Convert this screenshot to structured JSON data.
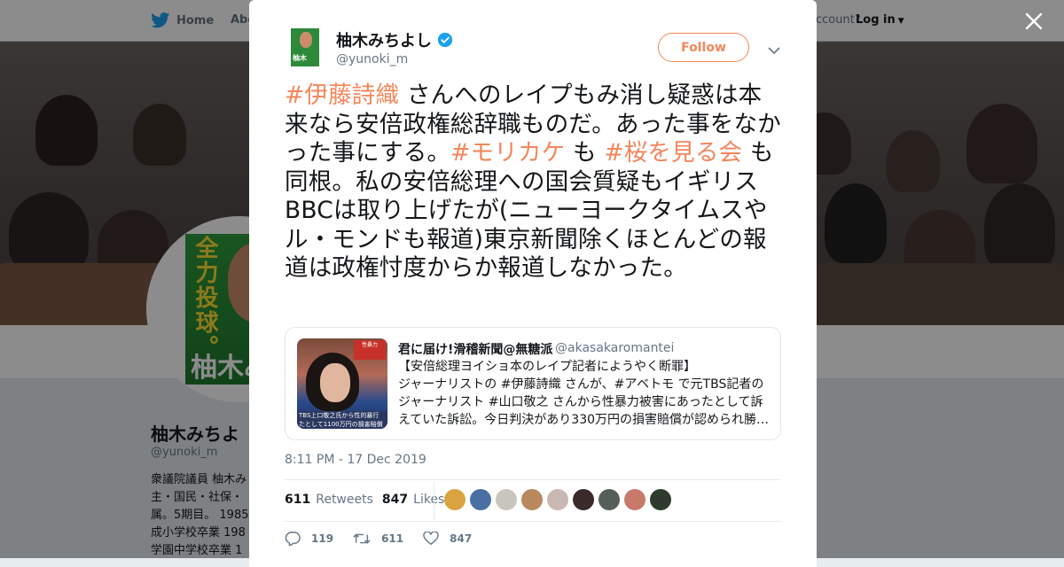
{
  "nav": {
    "home_label": "Home",
    "about_label": "Abo",
    "account_prompt": "ccount?",
    "login_label": "Log in"
  },
  "profile": {
    "name": "柚木みちよ",
    "handle": "@yunoki_m",
    "bio": "衆議院議員 柚木み\n主・国民・社保・\n属。5期目。 1985\n成小学校卒業 198\n学園中学校卒業 1",
    "avatar_text_top": "全力投球。",
    "avatar_text_bottom": "柚木み"
  },
  "tweet": {
    "author_name": "柚木みちよし",
    "author_handle": "@yunoki_m",
    "follow_label": "Follow",
    "body": [
      {
        "text": "#伊藤詩織",
        "tag": true
      },
      {
        "text": " さんへのレイプもみ消し疑惑は本来なら安倍政権総辞職ものだ。あった事をなかった事にする。",
        "tag": false
      },
      {
        "text": "#モリカケ",
        "tag": true
      },
      {
        "text": " も ",
        "tag": false
      },
      {
        "text": "#桜を見る会",
        "tag": true
      },
      {
        "text": " も同根。私の安倍総理への国会質疑もイギリスBBCは取り上げたが(ニューヨークタイムスやル・モンドも報道)東京新聞除くほとんどの報道は政権忖度からか報道しなかった。",
        "tag": false
      }
    ],
    "timestamp": "8:11 PM - 17 Dec 2019",
    "retweets_count": "611",
    "retweets_label": "Retweets",
    "likes_count": "847",
    "likes_label": "Likes",
    "reply_count": "119",
    "retweet_action_count": "611",
    "like_action_count": "847"
  },
  "quoted": {
    "name": "君に届け!滑稽新聞@無糖派",
    "handle": "@akasakaromantei",
    "text": "【安倍総理ヨイショ本のレイプ記者にようやく断罪】\nジャーナリストの #伊藤詩織 さんが、#アベトモ で元TBS記者のジャーナリスト #山口敬之 さんから性暴力被害にあったとして訴えていた訴訟。今日判決があり330万円の損害賠償が認められ勝…",
    "thumb_caption": "TBS上口敬之氏から性的暴行\nたとして1100万円の損害賠償",
    "thumb_badge": "性暴力"
  },
  "colors": {
    "accent": "#f4865b",
    "twitter_blue": "#1da1f2",
    "verified": "#1da1f2"
  },
  "likers": [
    "#d9a441",
    "#4a6fa5",
    "#c8c4be",
    "#b9885d",
    "#c9b8b1",
    "#3a2a2a",
    "#555f57",
    "#c87a6a",
    "#2f3a2e"
  ]
}
